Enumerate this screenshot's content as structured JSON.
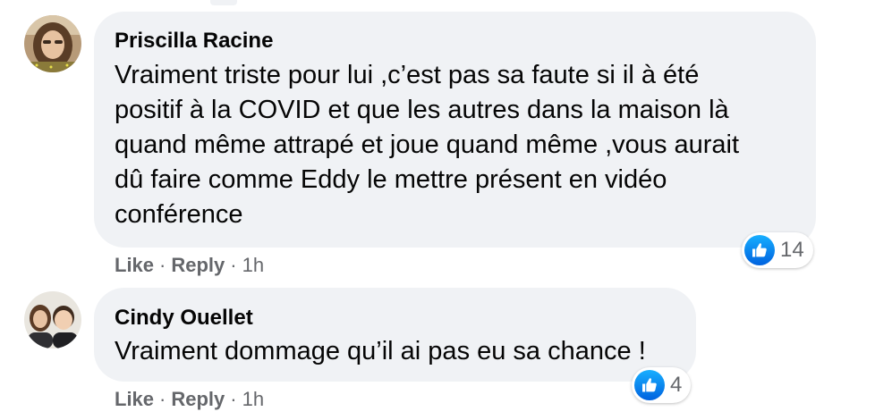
{
  "comments": [
    {
      "author": "Priscilla Racine",
      "text_lines": [
        "Vraiment triste pour lui ,c’est pas sa faute si il à été",
        "positif à la COVID et que les autres dans la maison là",
        "quand même attrapé et joue quand même ,vous aurait",
        "dû faire comme Eddy le mettre présent en vidéo",
        "conférence"
      ],
      "like_label": "Like",
      "separator": "·",
      "reply_label": "Reply",
      "time": "1h",
      "reaction_count": "14",
      "reaction_icon": "thumbs-up-icon"
    },
    {
      "author": "Cindy Ouellet",
      "text_lines": [
        "Vraiment dommage qu’il ai pas eu sa chance !"
      ],
      "like_label": "Like",
      "separator": "·",
      "reply_label": "Reply",
      "time": "1h",
      "reaction_count": "4",
      "reaction_icon": "thumbs-up-icon"
    }
  ],
  "colors": {
    "bubble": "#f0f2f5",
    "meta_text": "#65676b",
    "body_text": "#050505",
    "like_blue": "#1877f2"
  }
}
